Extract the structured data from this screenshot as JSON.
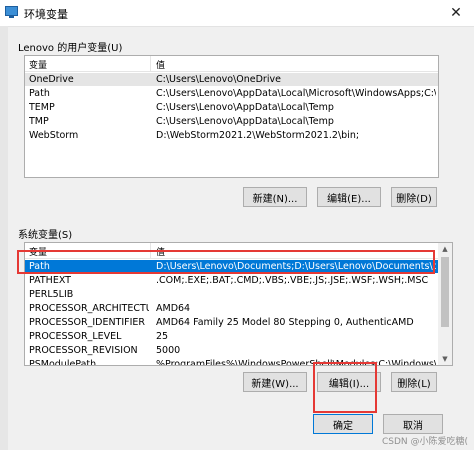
{
  "window": {
    "title": "环境变量",
    "close_glyph": "✕"
  },
  "user_vars": {
    "group_label": "Lenovo 的用户变量(U)",
    "columns": [
      "变量",
      "值"
    ],
    "rows": [
      {
        "name": "OneDrive",
        "value": "C:\\Users\\Lenovo\\OneDrive"
      },
      {
        "name": "Path",
        "value": "C:\\Users\\Lenovo\\AppData\\Local\\Microsoft\\WindowsApps;C:\\Progr..."
      },
      {
        "name": "TEMP",
        "value": "C:\\Users\\Lenovo\\AppData\\Local\\Temp"
      },
      {
        "name": "TMP",
        "value": "C:\\Users\\Lenovo\\AppData\\Local\\Temp"
      },
      {
        "name": "WebStorm",
        "value": "D:\\WebStorm2021.2\\WebStorm2021.2\\bin;"
      }
    ],
    "buttons": {
      "new": "新建(N)...",
      "edit": "编辑(E)...",
      "delete": "删除(D)"
    }
  },
  "system_vars": {
    "group_label": "系统变量(S)",
    "columns": [
      "变量",
      "值"
    ],
    "rows": [
      {
        "name": "Path",
        "value": "D:\\Users\\Lenovo\\Documents;D:\\Users\\Lenovo\\Documents\\bin;D:\\O..."
      },
      {
        "name": "PATHEXT",
        "value": ".COM;.EXE;.BAT;.CMD;.VBS;.VBE;.JS;.JSE;.WSF;.WSH;.MSC"
      },
      {
        "name": "PERL5LIB",
        "value": ""
      },
      {
        "name": "PROCESSOR_ARCHITECTURE",
        "value": "AMD64"
      },
      {
        "name": "PROCESSOR_IDENTIFIER",
        "value": "AMD64 Family 25 Model 80 Stepping 0, AuthenticAMD"
      },
      {
        "name": "PROCESSOR_LEVEL",
        "value": "25"
      },
      {
        "name": "PROCESSOR_REVISION",
        "value": "5000"
      },
      {
        "name": "PSModulePath",
        "value": "%ProgramFiles%\\WindowsPowerShell\\Modules;C:\\Windows\\syste..."
      }
    ],
    "buttons": {
      "new": "新建(W)...",
      "edit": "编辑(I)...",
      "delete": "删除(L)"
    }
  },
  "footer": {
    "ok": "确定",
    "cancel": "取消"
  },
  "watermark": "CSDN @小陈爱吃糖(",
  "colors": {
    "selection": "#0078d7",
    "highlight_box": "#e53935"
  }
}
